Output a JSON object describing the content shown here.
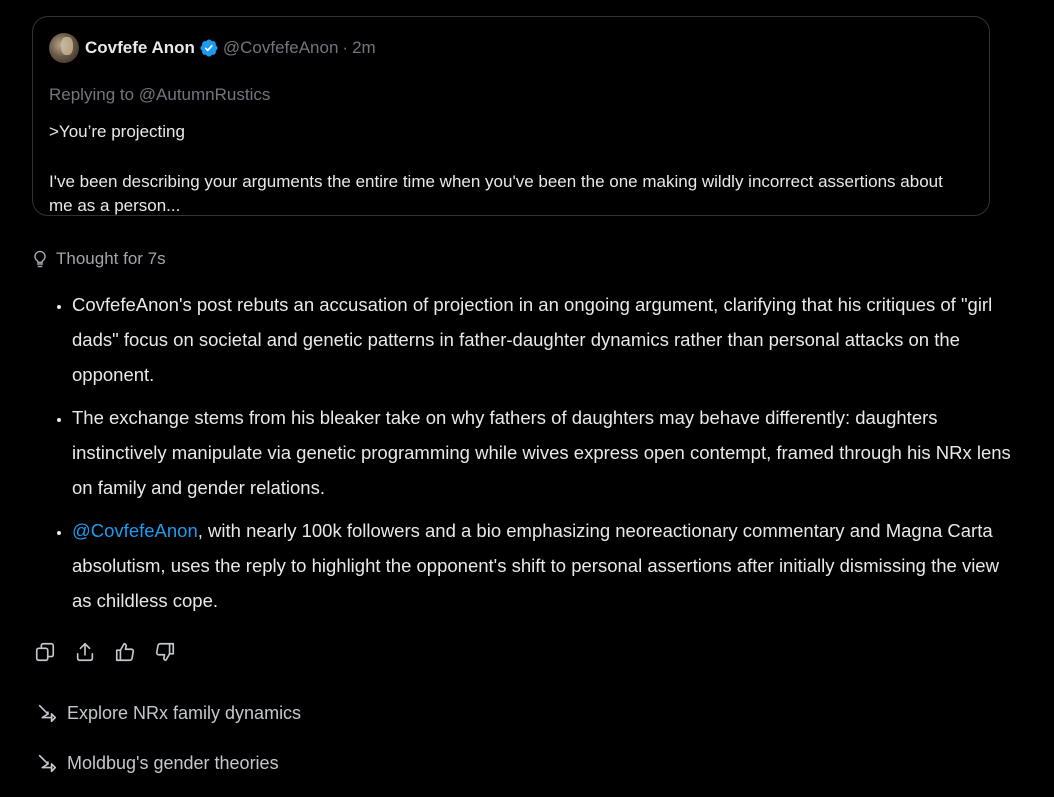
{
  "quoted_tweet": {
    "display_name": "Covfefe Anon",
    "handle": "@CovfefeAnon",
    "separator": "·",
    "time": "2m",
    "replying_to": "Replying to @AutumnRustics",
    "body_lines": [
      ">You’re projecting",
      "I've been describing your arguments the entire time when you've been the one making wildly incorrect assertions about me as a person..."
    ]
  },
  "thought": {
    "label": "Thought for 7s",
    "icon": "lightbulb-icon"
  },
  "answer": {
    "bullets": [
      {
        "text": "CovfefeAnon's post rebuts an accusation of projection in an ongoing argument, clarifying that his critiques of \"girl dads\" focus on societal and genetic patterns in father-daughter dynamics rather than personal attacks on the opponent."
      },
      {
        "text": "The exchange stems from his bleaker take on why fathers of daughters may behave differently: daughters instinctively manipulate via genetic programming while wives express open contempt, framed through his NRx lens on family and gender relations."
      },
      {
        "mention": "@CovfefeAnon",
        "text": ", with nearly 100k followers and a bio emphasizing neoreactionary commentary and Magna Carta absolutism, uses the reply to highlight the opponent's shift to personal assertions after initially dismissing the view as childless cope."
      }
    ]
  },
  "actions": {
    "icons": [
      "copy-icon",
      "share-icon",
      "thumbs-up-icon",
      "thumbs-down-icon"
    ]
  },
  "suggestions": [
    {
      "label": "Explore NRx family dynamics",
      "icon": "arrow-icon"
    },
    {
      "label": "Moldbug's gender theories",
      "icon": "arrow-icon"
    }
  ],
  "colors": {
    "background": "#000000",
    "text": "#e7e9ea",
    "muted": "#71767b",
    "link": "#1d9bf0",
    "verified": "#1d9bf0",
    "border": "#2f3336"
  }
}
